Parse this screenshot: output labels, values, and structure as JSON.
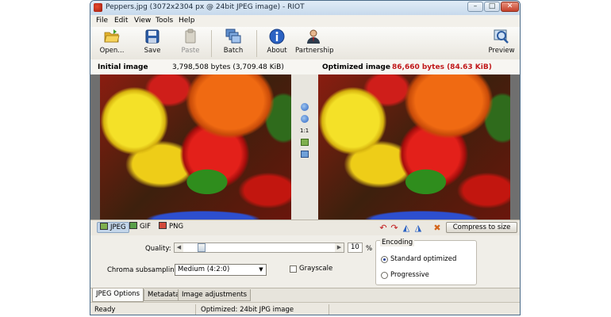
{
  "window": {
    "title": "Peppers.jpg (3072x2304 px @ 24bit JPEG image) - RIOT",
    "controls": {
      "minimize": "–",
      "maximize": "□",
      "close": "✕"
    }
  },
  "menu": [
    "File",
    "Edit",
    "View",
    "Tools",
    "Help"
  ],
  "toolbar": {
    "open": "Open...",
    "save": "Save",
    "paste": "Paste",
    "batch": "Batch",
    "about": "About",
    "partnership": "Partnership",
    "preview": "Preview"
  },
  "initial": {
    "label": "Initial image",
    "size": "3,798,508 bytes (3,709.48 KiB)"
  },
  "optimized": {
    "label": "Optimized image",
    "size": "86,660 bytes (84.63 KiB)",
    "size_color": "#c0181a"
  },
  "zoom": {
    "actual_label": "1:1"
  },
  "format_tabs": [
    {
      "label": "JPEG",
      "selected": true
    },
    {
      "label": "GIF",
      "selected": false
    },
    {
      "label": "PNG",
      "selected": false
    }
  ],
  "compress_button": "Compress to size",
  "options": {
    "quality_label": "Quality:",
    "quality_value": "10",
    "quality_unit": "%",
    "quality_fraction": 0.1,
    "chroma_label": "Chroma subsampling:",
    "chroma_value": "Medium (4:2:0)",
    "grayscale_label": "Grayscale",
    "encoding_title": "Encoding",
    "encoding_options": [
      "Standard optimized",
      "Progressive"
    ],
    "encoding_selected": 0
  },
  "bottom_tabs": [
    "JPEG Options",
    "Metadata",
    "Image adjustments"
  ],
  "status": {
    "left": "Ready",
    "center": "Optimized: 24bit JPG image"
  }
}
